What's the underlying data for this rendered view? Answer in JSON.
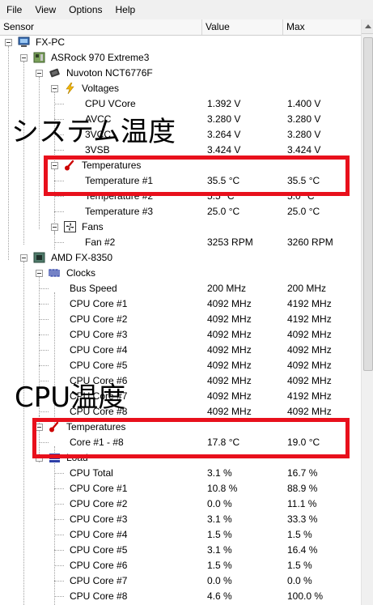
{
  "menu": [
    "File",
    "View",
    "Options",
    "Help"
  ],
  "columns": {
    "sensor": "Sensor",
    "value": "Value",
    "max": "Max"
  },
  "rows": [
    {
      "name": "FX-PC",
      "value": "",
      "max": ""
    },
    {
      "name": "ASRock 970 Extreme3",
      "value": "",
      "max": ""
    },
    {
      "name": "Nuvoton NCT6776F",
      "value": "",
      "max": ""
    },
    {
      "name": "Voltages",
      "value": "",
      "max": ""
    },
    {
      "name": "CPU VCore",
      "value": "1.392 V",
      "max": "1.400 V"
    },
    {
      "name": "AVCC",
      "value": "3.280 V",
      "max": "3.280 V"
    },
    {
      "name": "3VCC",
      "value": "3.264 V",
      "max": "3.280 V"
    },
    {
      "name": "3VSB",
      "value": "3.424 V",
      "max": "3.424 V"
    },
    {
      "name": "Temperatures",
      "value": "",
      "max": ""
    },
    {
      "name": "Temperature #1",
      "value": "35.5 °C",
      "max": "35.5 °C"
    },
    {
      "name": "Temperature #2",
      "value": "5.5 °C",
      "max": "5.0 °C"
    },
    {
      "name": "Temperature #3",
      "value": "25.0 °C",
      "max": "25.0 °C"
    },
    {
      "name": "Fans",
      "value": "",
      "max": ""
    },
    {
      "name": "Fan #2",
      "value": "3253 RPM",
      "max": "3260 RPM"
    },
    {
      "name": "AMD FX-8350",
      "value": "",
      "max": ""
    },
    {
      "name": "Clocks",
      "value": "",
      "max": ""
    },
    {
      "name": "Bus Speed",
      "value": "200 MHz",
      "max": "200 MHz"
    },
    {
      "name": "CPU Core #1",
      "value": "4092 MHz",
      "max": "4192 MHz"
    },
    {
      "name": "CPU Core #2",
      "value": "4092 MHz",
      "max": "4192 MHz"
    },
    {
      "name": "CPU Core #3",
      "value": "4092 MHz",
      "max": "4092 MHz"
    },
    {
      "name": "CPU Core #4",
      "value": "4092 MHz",
      "max": "4092 MHz"
    },
    {
      "name": "CPU Core #5",
      "value": "4092 MHz",
      "max": "4092 MHz"
    },
    {
      "name": "CPU Core #6",
      "value": "4092 MHz",
      "max": "4092 MHz"
    },
    {
      "name": "CPU Core #7",
      "value": "4092 MHz",
      "max": "4192 MHz"
    },
    {
      "name": "CPU Core #8",
      "value": "4092 MHz",
      "max": "4092 MHz"
    },
    {
      "name": "Temperatures",
      "value": "",
      "max": ""
    },
    {
      "name": "Core #1 - #8",
      "value": "17.8 °C",
      "max": "19.0 °C"
    },
    {
      "name": "Load",
      "value": "",
      "max": ""
    },
    {
      "name": "CPU Total",
      "value": "3.1 %",
      "max": "16.7 %"
    },
    {
      "name": "CPU Core #1",
      "value": "10.8 %",
      "max": "88.9 %"
    },
    {
      "name": "CPU Core #2",
      "value": "0.0 %",
      "max": "11.1 %"
    },
    {
      "name": "CPU Core #3",
      "value": "3.1 %",
      "max": "33.3 %"
    },
    {
      "name": "CPU Core #4",
      "value": "1.5 %",
      "max": "1.5 %"
    },
    {
      "name": "CPU Core #5",
      "value": "3.1 %",
      "max": "16.4 %"
    },
    {
      "name": "CPU Core #6",
      "value": "1.5 %",
      "max": "1.5 %"
    },
    {
      "name": "CPU Core #7",
      "value": "0.0 %",
      "max": "0.0 %"
    },
    {
      "name": "CPU Core #8",
      "value": "4.6 %",
      "max": "100.0 %"
    }
  ],
  "annotations": {
    "system_temp": "システム温度",
    "cpu_temp": "CPU温度",
    "highlight_color": "#e8101c"
  }
}
